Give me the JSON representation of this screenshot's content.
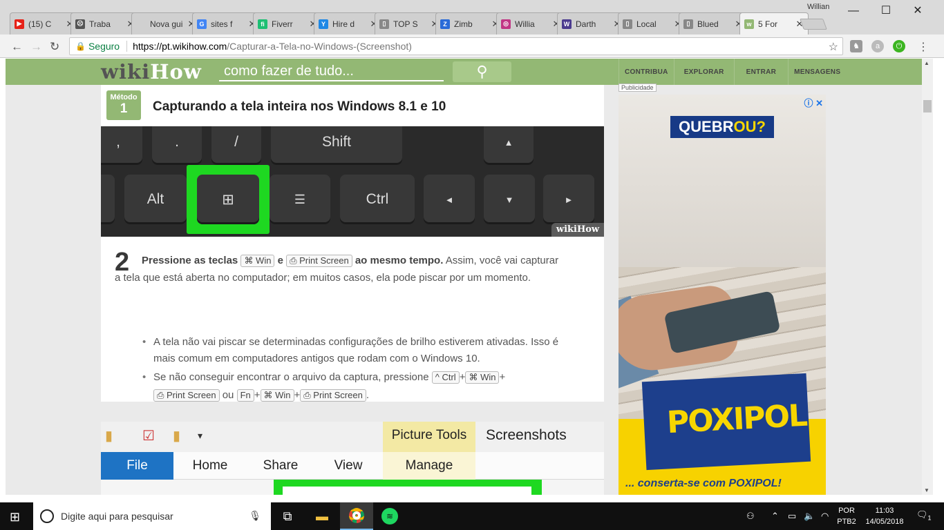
{
  "browser": {
    "user_name": "Willian",
    "tabs": [
      {
        "title": "(15) C",
        "color": "#e62117",
        "glyph": "▶"
      },
      {
        "title": "Traba",
        "color": "#555555",
        "glyph": "☹"
      },
      {
        "title": "Nova gui",
        "color": "",
        "glyph": ""
      },
      {
        "title": "sites f",
        "color": "#4285f4",
        "glyph": "G"
      },
      {
        "title": "Fiverr",
        "color": "#1dbf73",
        "glyph": "fi"
      },
      {
        "title": "Hire d",
        "color": "#1e88e5",
        "glyph": "Y"
      },
      {
        "title": "TOP S",
        "color": "#888888",
        "glyph": "▯"
      },
      {
        "title": "Zimb",
        "color": "#2a6bd8",
        "glyph": "Z"
      },
      {
        "title": "Willia",
        "color": "#c13584",
        "glyph": "◎"
      },
      {
        "title": "Darth",
        "color": "#4b3b8f",
        "glyph": "W"
      },
      {
        "title": "Local",
        "color": "#888888",
        "glyph": "▯"
      },
      {
        "title": "Blued",
        "color": "#888888",
        "glyph": "▯"
      },
      {
        "title": "5 For",
        "color": "#93b874",
        "glyph": "w"
      }
    ],
    "secure_label": "Seguro",
    "url_host": "https://pt.wikihow.com",
    "url_path": "/Capturar-a-Tela-no-Windows-(Screenshot)"
  },
  "site": {
    "logo_wiki": "wiki",
    "logo_how": "How",
    "search_placeholder": "como fazer de tudo...",
    "nav": [
      "CONTRIBUA",
      "EXPLORAR",
      "ENTRAR",
      "MENSAGENS"
    ],
    "ad_label": "Publicidade"
  },
  "method": {
    "label": "Método",
    "number": "1",
    "title": "Capturando a tela inteira nos Windows 8.1 e 10"
  },
  "keyboard": {
    "keys": [
      "Shift",
      "Alt",
      "Ctrl",
      "▲",
      "◄",
      "▼",
      "►",
      "/",
      ".",
      ","
    ],
    "watermark_wiki": "wiki",
    "watermark_how": "How"
  },
  "step": {
    "number": "2",
    "bold_a": "Pressione as teclas",
    "key_win": "⌘ Win",
    "bold_and": "e",
    "key_print": "⎙ Print Screen",
    "bold_b": "ao mesmo tempo.",
    "text": "Assim, você vai capturar a tela que está aberta no computador; em muitos casos, ela pode piscar por um momento.",
    "bullet1": "A tela não vai piscar se determinadas configurações de brilho estiverem ativadas. Isso é mais comum em computadores antigos que rodam com o Windows 10.",
    "bullet2_pre": "Se não conseguir encontrar o arquivo da captura, pressione",
    "k_ctrl": "^ Ctrl",
    "k_win": "⌘ Win",
    "k_print": "⎙ Print Screen",
    "k_fn": "Fn",
    "plus": "+",
    "or": "ou",
    "end": "."
  },
  "explorer": {
    "picture_tools": "Picture Tools",
    "screenshots": "Screenshots",
    "tabs": [
      "File",
      "Home",
      "Share",
      "View",
      "Manage"
    ]
  },
  "ad": {
    "headline_a": "QUEBR",
    "headline_b": "OU?",
    "brand": "POXIPOL",
    "tagline": "... conserta-se com POXIPOL!"
  },
  "taskbar": {
    "search_placeholder": "Digite aqui para pesquisar",
    "lang1": "POR",
    "lang2": "PTB2",
    "time": "11:03",
    "date": "14/05/2018",
    "notif": "1"
  }
}
